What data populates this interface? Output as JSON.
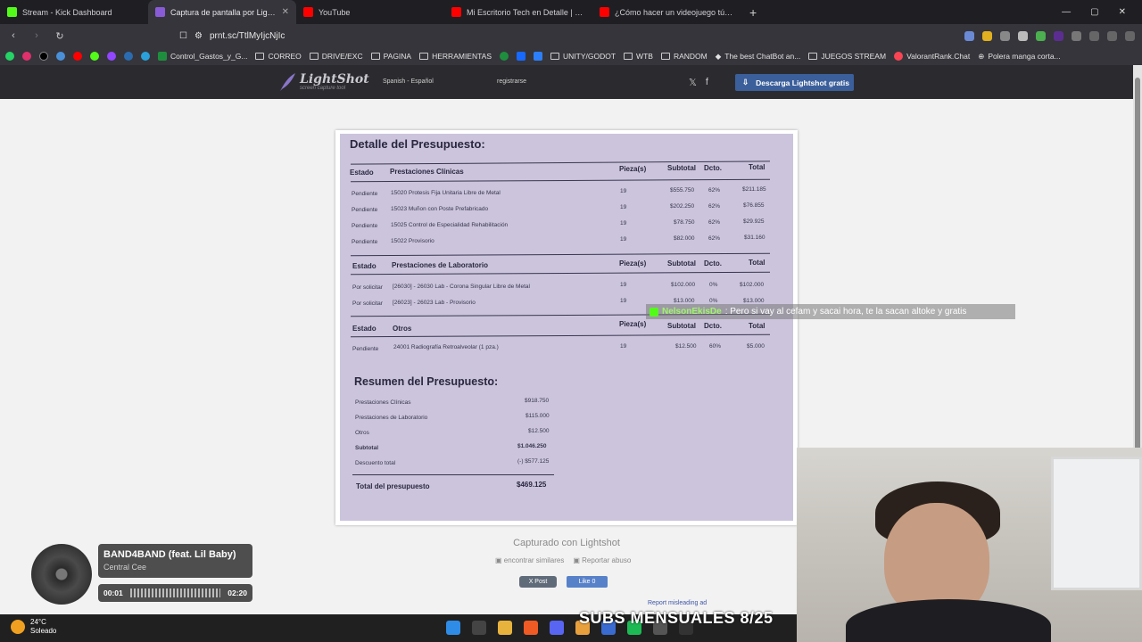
{
  "browser": {
    "tabs": [
      {
        "title": "Stream - Kick Dashboard",
        "color": "#53fc18"
      },
      {
        "title": "Captura de pantalla por Lightsh",
        "color": "#8a5bd6"
      },
      {
        "title": "YouTube",
        "color": "#ff0000"
      },
      {
        "title": "Mi Escritorio Tech en Detalle | 2025",
        "color": "#ff0000"
      },
      {
        "title": "¿Cómo hacer un videojuego tú solo?",
        "color": "#ff0000"
      }
    ],
    "new_tab": "+",
    "url": "prnt.sc/TtlMyIjcNjIc",
    "bookmarks": [
      "Control_Gastos_y_G...",
      "CORREO",
      "DRIVE/EXC",
      "PAGINA",
      "HERRAMIENTAS",
      "UNITY/GODOT",
      "WTB",
      "RANDOM",
      "The best ChatBot an...",
      "JUEGOS STREAM",
      "ValorantRank.Chat",
      "Polera manga corta..."
    ]
  },
  "lightshot": {
    "logo_name": "LightShot",
    "logo_tag": "screen capture tool",
    "language": "Spanish - Español",
    "register": "registrarse",
    "download_button": "Descarga Lightshot gratis"
  },
  "document": {
    "title": "Detalle del Presupuesto:",
    "sections": [
      {
        "headers": [
          "Estado",
          "Prestaciones Clínicas",
          "Pieza(s)",
          "Subtotal",
          "Dcto.",
          "Total"
        ],
        "rows": [
          [
            "Pendiente",
            "15020  Protesis Fija Unitaria Libre de Metal",
            "19",
            "$555.750",
            "62%",
            "$211.185"
          ],
          [
            "Pendiente",
            "15023  Muñon con Poste Prefabricado",
            "19",
            "$202.250",
            "62%",
            "$76.855"
          ],
          [
            "Pendiente",
            "15025  Control de Especialidad Rehabilitación",
            "19",
            "$78.750",
            "62%",
            "$29.925"
          ],
          [
            "Pendiente",
            "15022  Provisorio",
            "19",
            "$82.000",
            "62%",
            "$31.160"
          ]
        ]
      },
      {
        "headers": [
          "Estado",
          "Prestaciones de Laboratorio",
          "Pieza(s)",
          "Subtotal",
          "Dcto.",
          "Total"
        ],
        "rows": [
          [
            "Por solicitar",
            "[26030] - 26030 Lab - Corona Singular Libre de Metal",
            "19",
            "$102.000",
            "0%",
            "$102.000"
          ],
          [
            "Por solicitar",
            "[26023] - 26023 Lab - Provisorio",
            "19",
            "$13.000",
            "0%",
            "$13.000"
          ]
        ]
      },
      {
        "headers": [
          "Estado",
          "Otros",
          "Pieza(s)",
          "Subtotal",
          "Dcto.",
          "Total"
        ],
        "rows": [
          [
            "Pendiente",
            "24001 Radiografía Retroalveolar (1 pza.)",
            "19",
            "$12.500",
            "60%",
            "$5.000"
          ]
        ]
      }
    ],
    "summary_title": "Resumen del Presupuesto:",
    "summary": [
      [
        "Prestaciones Clínicas",
        "$918.750"
      ],
      [
        "Prestaciones de Laboratorio",
        "$115.000"
      ],
      [
        "Otros",
        "$12.500"
      ],
      [
        "Subtotal",
        "$1.046.250"
      ],
      [
        "Descuento total",
        "(-) $577.125"
      ]
    ],
    "total_label": "Total del presupuesto",
    "total_value": "$469.125"
  },
  "page": {
    "caption": "Capturado con Lightshot",
    "similar": "encontrar similares",
    "report_abuse": "Reportar abuso",
    "x_post": "X Post",
    "fb_like": "Like 0",
    "report_ad": "Report misleading ad"
  },
  "chat": {
    "user": "NelsonEkisDe",
    "message": ": Pero si vay al cefam y sacai hora, te la sacan altoke y gratis"
  },
  "player": {
    "song": "BAND4BAND (feat. Lil Baby)",
    "artist": "Central Cee",
    "elapsed": "00:01",
    "duration": "02:20"
  },
  "overlay": {
    "subs": "SUBS MENSUALES 8/25"
  },
  "taskbar": {
    "temperature": "24°C",
    "condition": "Soleado"
  }
}
